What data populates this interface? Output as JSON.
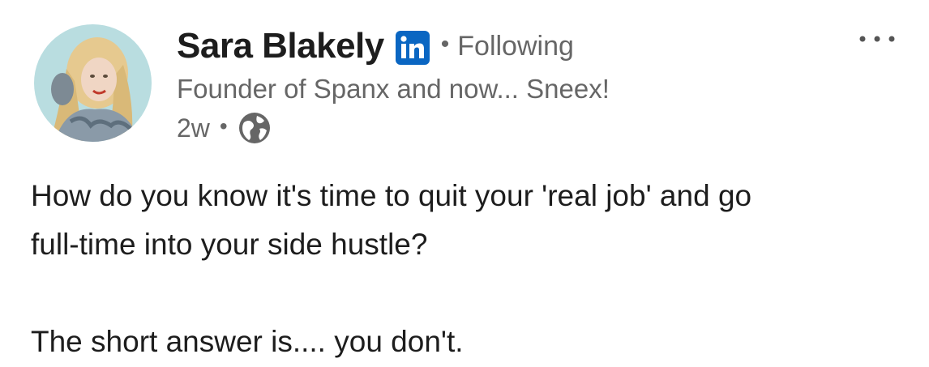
{
  "post": {
    "author": {
      "name": "Sara Blakely",
      "badge_icon": "linkedin-icon",
      "follow_status": "Following",
      "headline": "Founder of Spanx and now... Sneex!",
      "time_ago": "2w",
      "visibility_icon": "globe-icon"
    },
    "menu_icon": "more-horizontal-icon",
    "body": {
      "line1": "How do you know it's time to quit your 'real job' and go",
      "line2": "full-time into your side hustle?",
      "line3": "The short answer is.... you don't."
    }
  },
  "colors": {
    "text_primary": "#1d1d1d",
    "text_secondary": "#666666",
    "linkedin_blue": "#0a66c2",
    "avatar_bg": "#b9dde0"
  }
}
